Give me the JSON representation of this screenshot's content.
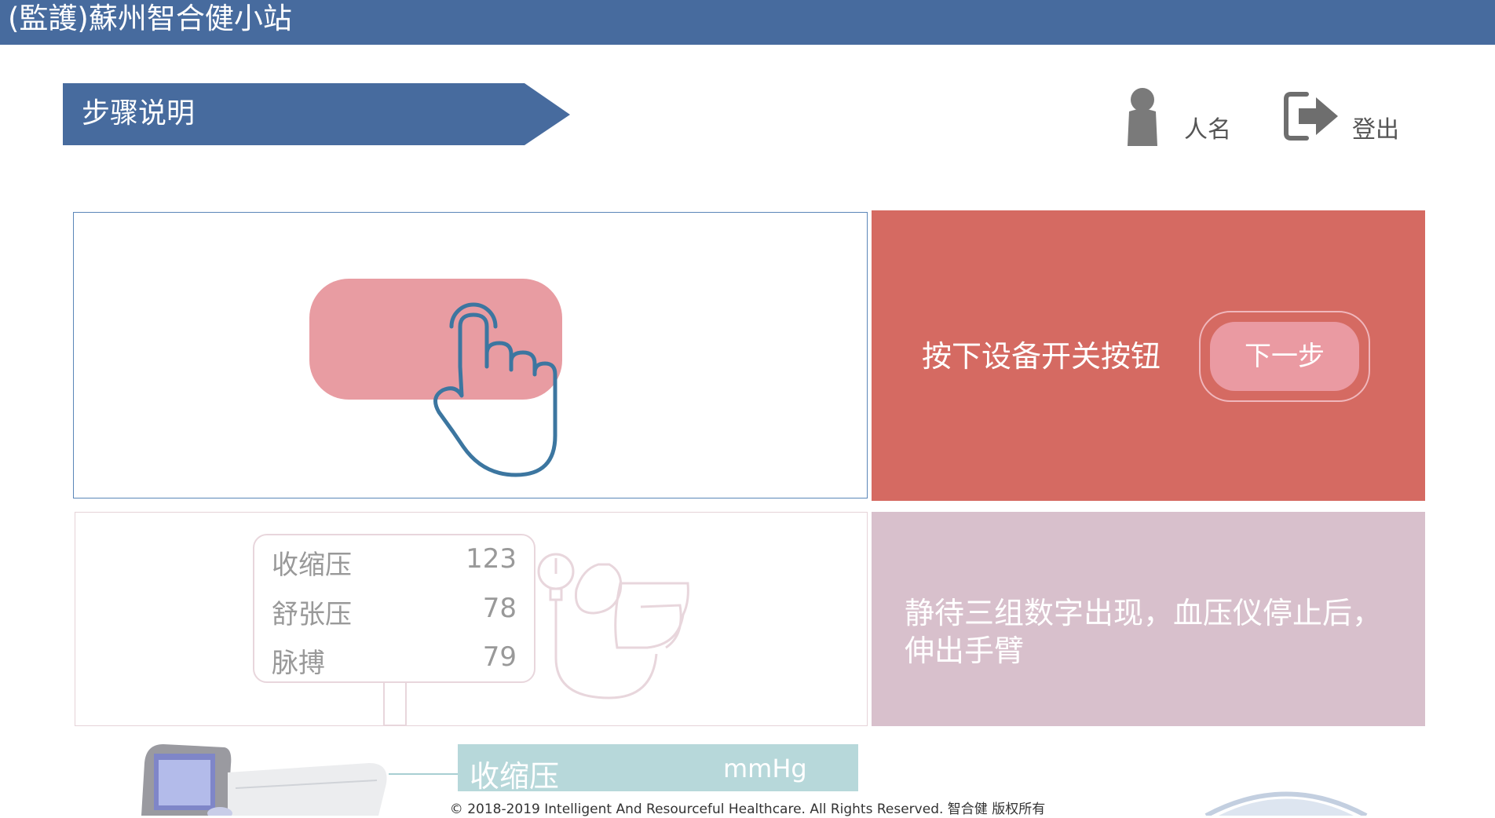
{
  "header": {
    "title": "(監護)蘇州智合健小站"
  },
  "step_banner": {
    "label": "步骤说明"
  },
  "user": {
    "name": "人名",
    "icon": "person-icon"
  },
  "logout": {
    "label": "登出",
    "icon": "logout-icon"
  },
  "step1": {
    "instruction": "按下设备开关按钮",
    "next_button": "下一步",
    "illustration": "press-button-hand"
  },
  "step2": {
    "instruction": "静待三组数字出现，血压仪停止后，伸出手臂",
    "readings": [
      {
        "label": "收缩压",
        "value": "123"
      },
      {
        "label": "舒张压",
        "value": "78"
      },
      {
        "label": "脉搏",
        "value": "79"
      }
    ]
  },
  "step3_preview": {
    "label": "收缩压",
    "unit": "mmHg"
  },
  "footer": {
    "copyright": "© 2018-2019 Intelligent And Resourceful Healthcare. All Rights Reserved. 智合健 版权所有"
  },
  "colors": {
    "header_bg": "#476b9e",
    "step1_bg": "#d56a62",
    "step2_bg": "#d8c0cc",
    "button_bg": "#ea9aa2",
    "preview_bar": "#b7d8da"
  }
}
